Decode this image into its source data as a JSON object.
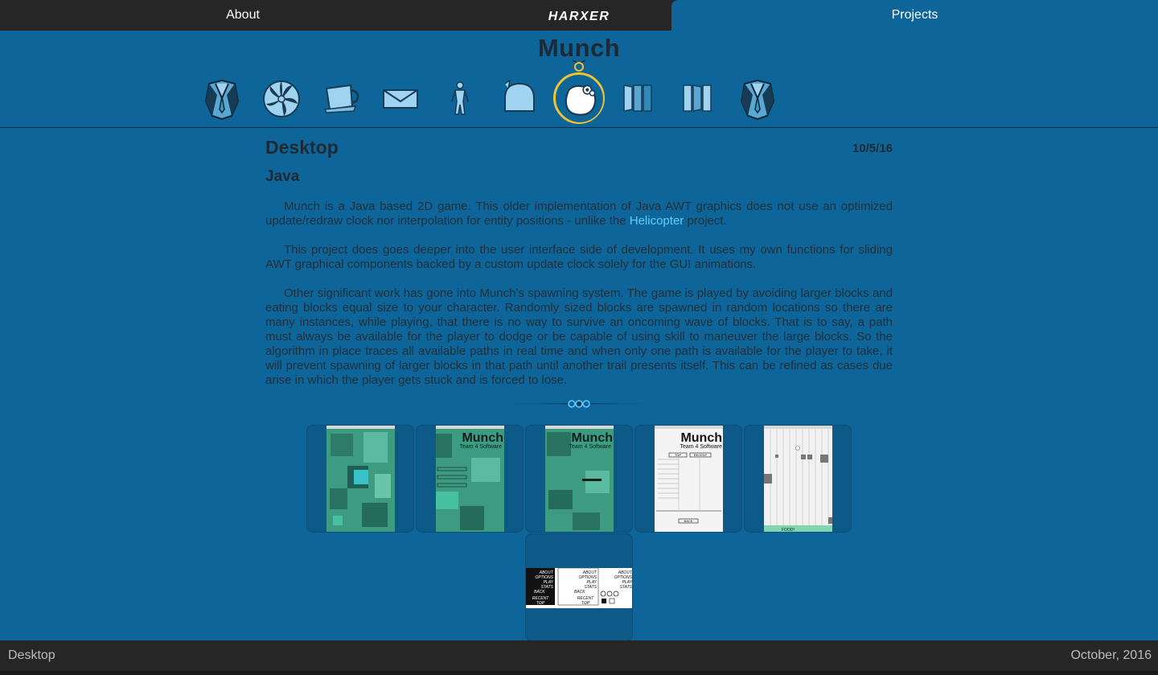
{
  "nav": {
    "about_label": "About",
    "logo_text": "HARXER",
    "projects_label": "Projects"
  },
  "project": {
    "title": "Munch",
    "platform": "Desktop",
    "date": "10/5/16",
    "language": "Java",
    "paragraphs": [
      {
        "before": "Munch is a Java based 2D game. This older implementation of Java AWT graphics does not use an optimized update/redraw clock nor interpolation for entity positions - unlike the ",
        "link": "Helicopter",
        "after": " project."
      },
      {
        "before": "This project does goes deeper into the user interface side of development. It uses my own functions for sliding AWT graphical components backed by a custom update clock solely for the GUI animations.",
        "link": "",
        "after": ""
      },
      {
        "before": "Other significant work has gone into Munch’s spawning system. The game is played by avoiding larger blocks and eating blocks equal size to your character. Randomly sized blocks are spawned in random locations so there are many instances, while playing, that there is no way to survive an oncoming wave of blocks. That is to say, a path must always be available for the player to dodge or be capable of using skill to maneuver the large blocks. So the algorithm in place traces all available paths in real time and when only one path is available for the player to take, it will prevent spawning of larger blocks in that path until another trail presents itself. This can be refined as cases due arise in which the player gets stuck and is forced to lose.",
        "link": "",
        "after": ""
      }
    ]
  },
  "project_icons": [
    {
      "name": "tuxedo-icon",
      "active": false
    },
    {
      "name": "pinwheel-icon",
      "active": false
    },
    {
      "name": "coffee-cup-icon",
      "active": false
    },
    {
      "name": "envelope-icon",
      "active": false
    },
    {
      "name": "stick-figure-icon",
      "active": false
    },
    {
      "name": "bell-icon",
      "active": false
    },
    {
      "name": "munch-blob-icon",
      "active": true
    },
    {
      "name": "panels-icon",
      "active": false
    },
    {
      "name": "panels-alt-icon",
      "active": false
    },
    {
      "name": "tuxedo-alt-icon",
      "active": false
    }
  ],
  "gallery": {
    "screens": [
      {
        "name": "screenshot-gameplay"
      },
      {
        "name": "screenshot-main-menu"
      },
      {
        "name": "screenshot-menu-options"
      },
      {
        "name": "screenshot-scores"
      },
      {
        "name": "screenshot-level-view"
      },
      {
        "name": "screenshot-ui-sprites"
      }
    ],
    "overlay_texts": {
      "munch_title": "Munch",
      "team": "Team 4 Software",
      "top_button": "TOP",
      "recent_button": "RECENT",
      "back_button": "BACK",
      "food": "FOOD!"
    },
    "sprite_sheet_labels": [
      "ABOUT",
      "OPTIONS",
      "PLAY",
      "STATS",
      "BACK",
      "RECENT",
      "TOP"
    ]
  },
  "footer": {
    "left": "Desktop",
    "right": "October, 2016"
  },
  "colors": {
    "background": "#0e6599",
    "topbar": "#262626",
    "accent_ring": "#f0c430",
    "link": "#5ed0ff",
    "heading": "#1e2a33"
  }
}
